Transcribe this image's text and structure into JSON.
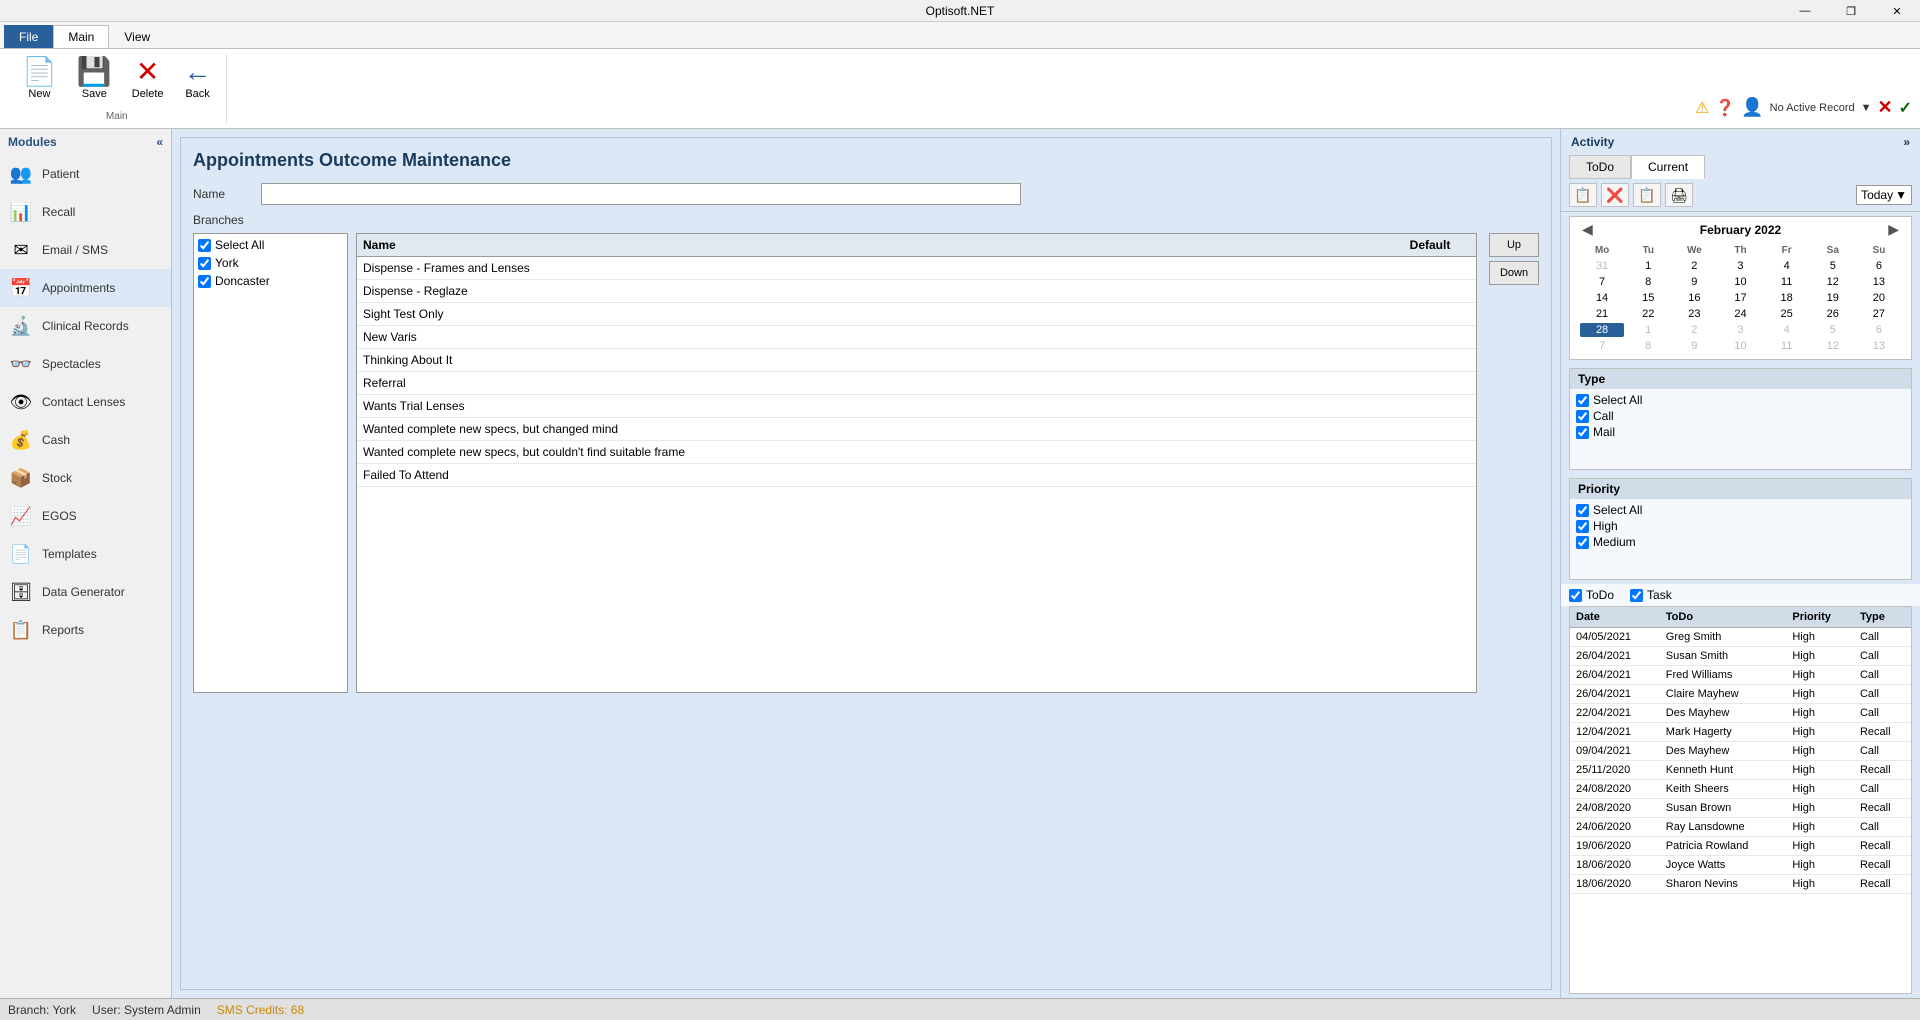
{
  "titleBar": {
    "title": "Optisoft.NET",
    "minimize": "—",
    "restore": "❐",
    "close": "✕"
  },
  "ribbon": {
    "tabs": [
      "File",
      "Main",
      "View"
    ],
    "activeTab": "Main",
    "buttons": [
      {
        "id": "new",
        "label": "New",
        "icon": "📄",
        "disabled": false
      },
      {
        "id": "save",
        "label": "Save",
        "icon": "💾",
        "disabled": false
      },
      {
        "id": "delete",
        "label": "Delete",
        "icon": "✕",
        "disabled": false
      },
      {
        "id": "back",
        "label": "Back",
        "icon": "←",
        "disabled": false
      }
    ],
    "groupLabel": "Main",
    "userRecord": "No Active Record",
    "dropdown": "▼"
  },
  "sidebar": {
    "title": "Modules",
    "collapseIcon": "«",
    "items": [
      {
        "id": "patient",
        "label": "Patient",
        "icon": "👥"
      },
      {
        "id": "recall",
        "label": "Recall",
        "icon": "📊"
      },
      {
        "id": "email-sms",
        "label": "Email / SMS",
        "icon": "✉"
      },
      {
        "id": "appointments",
        "label": "Appointments",
        "icon": "📅"
      },
      {
        "id": "clinical-records",
        "label": "Clinical Records",
        "icon": "🔬"
      },
      {
        "id": "spectacles",
        "label": "Spectacles",
        "icon": "👓"
      },
      {
        "id": "contact-lenses",
        "label": "Contact Lenses",
        "icon": "👁"
      },
      {
        "id": "cash",
        "label": "Cash",
        "icon": "💰"
      },
      {
        "id": "stock",
        "label": "Stock",
        "icon": "📦"
      },
      {
        "id": "egos",
        "label": "EGOS",
        "icon": "📈"
      },
      {
        "id": "templates",
        "label": "Templates",
        "icon": "📄"
      },
      {
        "id": "data-generator",
        "label": "Data Generator",
        "icon": "🗄"
      },
      {
        "id": "reports",
        "label": "Reports",
        "icon": "📋"
      }
    ]
  },
  "mainPanel": {
    "title": "Appointments Outcome Maintenance",
    "nameLabel": "Name",
    "namePlaceholder": "",
    "branchesLabel": "Branches",
    "branches": [
      {
        "label": "Select All",
        "checked": true
      },
      {
        "label": "York",
        "checked": true
      },
      {
        "label": "Doncaster",
        "checked": true
      }
    ],
    "outcomesHeader": {
      "name": "Name",
      "default": "Default"
    },
    "upButton": "Up",
    "downButton": "Down",
    "outcomes": [
      {
        "name": "Dispense - Frames and Lenses",
        "default": ""
      },
      {
        "name": "Dispense - Reglaze",
        "default": ""
      },
      {
        "name": "Sight Test Only",
        "default": ""
      },
      {
        "name": "New Varis",
        "default": ""
      },
      {
        "name": "Thinking About It",
        "default": ""
      },
      {
        "name": "Referral",
        "default": ""
      },
      {
        "name": "Wants Trial Lenses",
        "default": ""
      },
      {
        "name": "Wanted complete new specs, but changed mind",
        "default": ""
      },
      {
        "name": "Wanted complete new specs, but couldn't find suitable frame",
        "default": ""
      },
      {
        "name": "Failed To Attend",
        "default": ""
      }
    ]
  },
  "activity": {
    "title": "Activity",
    "expandIcon": "»",
    "tabs": [
      "ToDo",
      "Current"
    ],
    "activeTab": "Current",
    "toolbar": {
      "icons": [
        "📋",
        "❌",
        "📋",
        "🖨"
      ],
      "todayLabel": "Today",
      "dropdownIcon": "▼"
    },
    "calendar": {
      "prevIcon": "◀",
      "nextIcon": "▶",
      "month": "February 2022",
      "dayHeaders": [
        "Mo",
        "Tu",
        "We",
        "Th",
        "Fr",
        "Sa",
        "Su"
      ],
      "weeks": [
        [
          "31",
          "1",
          "2",
          "3",
          "4",
          "5",
          "6"
        ],
        [
          "7",
          "8",
          "9",
          "10",
          "11",
          "12",
          "13"
        ],
        [
          "14",
          "15",
          "16",
          "17",
          "18",
          "19",
          "20"
        ],
        [
          "21",
          "22",
          "23",
          "24",
          "25",
          "26",
          "27"
        ],
        [
          "28",
          "1",
          "2",
          "3",
          "4",
          "5",
          "6"
        ],
        [
          "7",
          "8",
          "9",
          "10",
          "11",
          "12",
          "13"
        ]
      ],
      "otherMonthRows": [
        0,
        4,
        5
      ],
      "todayCell": {
        "row": 4,
        "col": 0
      },
      "selectedCell": {
        "row": 4,
        "col": 0
      }
    },
    "typeSection": {
      "header": "Type",
      "items": [
        {
          "label": "Select All",
          "checked": true
        },
        {
          "label": "Call",
          "checked": true
        },
        {
          "label": "Mail",
          "checked": true
        }
      ]
    },
    "prioritySection": {
      "header": "Priority",
      "items": [
        {
          "label": "Select All",
          "checked": true
        },
        {
          "label": "High",
          "checked": true
        },
        {
          "label": "Medium",
          "checked": true
        }
      ]
    },
    "todoTaskRow": {
      "todoLabel": "ToDo",
      "todoChecked": true,
      "taskLabel": "Task",
      "taskChecked": true
    },
    "tableHeaders": [
      "Date",
      "ToDo",
      "Priority",
      "Type"
    ],
    "tableRows": [
      {
        "date": "04/05/2021",
        "todo": "Greg Smith",
        "priority": "High",
        "type": "Call"
      },
      {
        "date": "26/04/2021",
        "todo": "Susan Smith",
        "priority": "High",
        "type": "Call"
      },
      {
        "date": "26/04/2021",
        "todo": "Fred Williams",
        "priority": "High",
        "type": "Call"
      },
      {
        "date": "26/04/2021",
        "todo": "Claire Mayhew",
        "priority": "High",
        "type": "Call"
      },
      {
        "date": "22/04/2021",
        "todo": "Des Mayhew",
        "priority": "High",
        "type": "Call"
      },
      {
        "date": "12/04/2021",
        "todo": "Mark Hagerty",
        "priority": "High",
        "type": "Recall"
      },
      {
        "date": "09/04/2021",
        "todo": "Des Mayhew",
        "priority": "High",
        "type": "Call"
      },
      {
        "date": "25/11/2020",
        "todo": "Kenneth Hunt",
        "priority": "High",
        "type": "Recall"
      },
      {
        "date": "24/08/2020",
        "todo": "Keith Sheers",
        "priority": "High",
        "type": "Call"
      },
      {
        "date": "24/08/2020",
        "todo": "Susan Brown",
        "priority": "High",
        "type": "Recall"
      },
      {
        "date": "24/06/2020",
        "todo": "Ray Lansdowne",
        "priority": "High",
        "type": "Call"
      },
      {
        "date": "19/06/2020",
        "todo": "Patricia Rowland",
        "priority": "High",
        "type": "Recall"
      },
      {
        "date": "18/06/2020",
        "todo": "Joyce Watts",
        "priority": "High",
        "type": "Recall"
      },
      {
        "date": "18/06/2020",
        "todo": "Sharon Nevins",
        "priority": "High",
        "type": "Recall"
      }
    ]
  },
  "statusBar": {
    "branch": "Branch: York",
    "user": "User: System Admin",
    "sms": "SMS Credits: 68"
  }
}
